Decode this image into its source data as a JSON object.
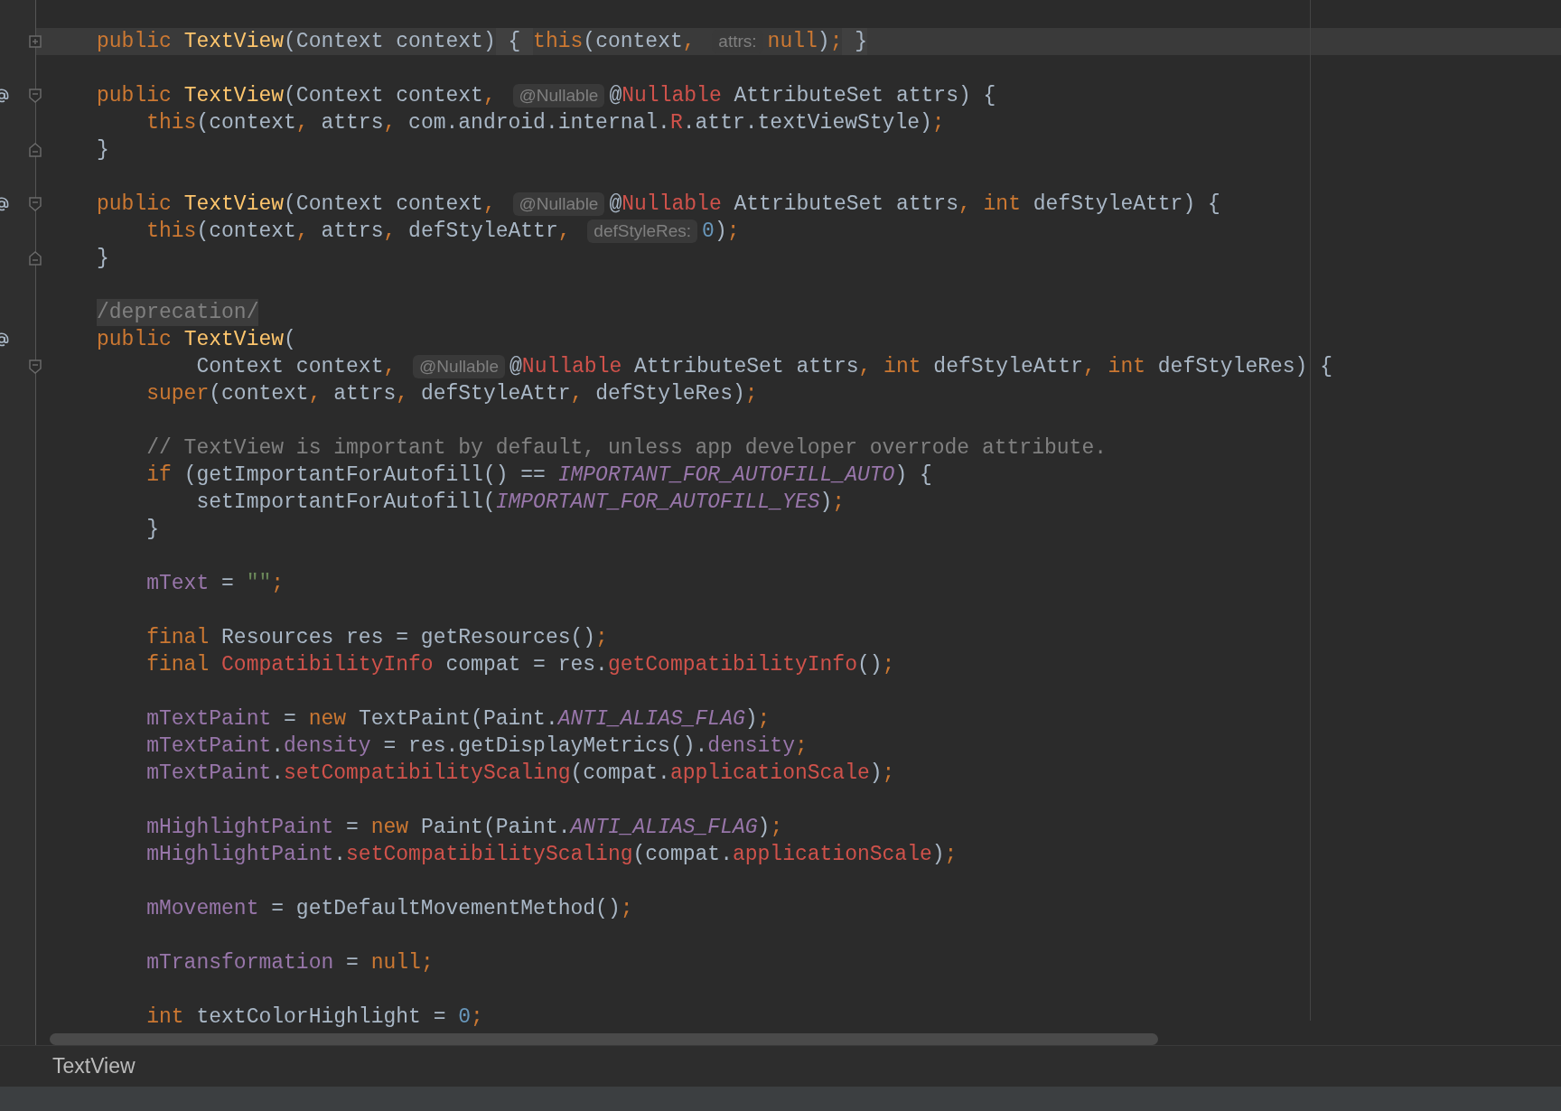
{
  "editor": {
    "lines": [
      {
        "tokens": [
          {
            "text": "public ",
            "kind": "keyword"
          },
          {
            "text": "TextView",
            "kind": "function"
          },
          {
            "text": "(Context context)",
            "kind": "plain"
          },
          {
            "text": " { ",
            "kind": "folded"
          },
          {
            "text": "this",
            "kind": "keyword"
          },
          {
            "text": "(context",
            "kind": "plain"
          },
          {
            "text": ", ",
            "kind": "keyword"
          },
          {
            "text": "attrs:",
            "kind": "hint"
          },
          {
            "text": "null",
            "kind": "keyword"
          },
          {
            "text": ")",
            "kind": "plain"
          },
          {
            "text": ";",
            "kind": "keyword"
          },
          {
            "text": " }",
            "kind": "folded"
          }
        ],
        "current": true,
        "marked": false,
        "fold": {
          "kind": "collapsed"
        }
      },
      {
        "current": false,
        "marked": false
      },
      {
        "tokens": [
          {
            "text": "public ",
            "kind": "keyword"
          },
          {
            "text": "TextView",
            "kind": "function"
          },
          {
            "text": "(Context context",
            "kind": "plain"
          },
          {
            "text": ", ",
            "kind": "keyword"
          },
          {
            "text": "@Nullable",
            "kind": "hint"
          },
          {
            "text": "@",
            "kind": "plain"
          },
          {
            "text": "Nullable",
            "kind": "error"
          },
          {
            "text": " AttributeSet attrs) {",
            "kind": "plain"
          }
        ],
        "current": false,
        "marked": true,
        "fold": {
          "kind": "start"
        }
      },
      {
        "tokens": [
          {
            "text": "    this",
            "kind": "keyword"
          },
          {
            "text": "(context",
            "kind": "plain"
          },
          {
            "text": ", ",
            "kind": "keyword"
          },
          {
            "text": "attrs",
            "kind": "plain"
          },
          {
            "text": ", ",
            "kind": "keyword"
          },
          {
            "text": "com.android.internal.",
            "kind": "plain"
          },
          {
            "text": "R",
            "kind": "error"
          },
          {
            "text": ".attr.textViewStyle)",
            "kind": "plain"
          },
          {
            "text": ";",
            "kind": "keyword"
          }
        ],
        "current": false,
        "marked": false
      },
      {
        "tokens": [
          {
            "text": "}",
            "kind": "plain"
          }
        ],
        "current": false,
        "marked": false,
        "fold": {
          "kind": "end"
        }
      },
      {
        "current": false,
        "marked": false
      },
      {
        "tokens": [
          {
            "text": "public ",
            "kind": "keyword"
          },
          {
            "text": "TextView",
            "kind": "function"
          },
          {
            "text": "(Context context",
            "kind": "plain"
          },
          {
            "text": ", ",
            "kind": "keyword"
          },
          {
            "text": "@Nullable",
            "kind": "hint"
          },
          {
            "text": "@",
            "kind": "plain"
          },
          {
            "text": "Nullable",
            "kind": "error"
          },
          {
            "text": " AttributeSet attrs",
            "kind": "plain"
          },
          {
            "text": ", ",
            "kind": "keyword"
          },
          {
            "text": "int ",
            "kind": "keyword"
          },
          {
            "text": "defStyleAttr) {",
            "kind": "plain"
          }
        ],
        "current": false,
        "marked": true,
        "fold": {
          "kind": "start"
        }
      },
      {
        "tokens": [
          {
            "text": "    this",
            "kind": "keyword"
          },
          {
            "text": "(context",
            "kind": "plain"
          },
          {
            "text": ", ",
            "kind": "keyword"
          },
          {
            "text": "attrs",
            "kind": "plain"
          },
          {
            "text": ", ",
            "kind": "keyword"
          },
          {
            "text": "defStyleAttr",
            "kind": "plain"
          },
          {
            "text": ", ",
            "kind": "keyword"
          },
          {
            "text": "defStyleRes:",
            "kind": "hint"
          },
          {
            "text": "0",
            "kind": "number"
          },
          {
            "text": ")",
            "kind": "plain"
          },
          {
            "text": ";",
            "kind": "keyword"
          }
        ],
        "current": false,
        "marked": false
      },
      {
        "tokens": [
          {
            "text": "}",
            "kind": "plain"
          }
        ],
        "current": false,
        "marked": false,
        "fold": {
          "kind": "end"
        }
      },
      {
        "current": false,
        "marked": false
      },
      {
        "tokens": [
          {
            "text": "/deprecation/",
            "kind": "deprecation"
          }
        ],
        "current": false,
        "marked": false
      },
      {
        "tokens": [
          {
            "text": "public ",
            "kind": "keyword"
          },
          {
            "text": "TextView",
            "kind": "function"
          },
          {
            "text": "(",
            "kind": "plain"
          }
        ],
        "current": false,
        "marked": true
      },
      {
        "tokens": [
          {
            "text": "        Context context",
            "kind": "plain"
          },
          {
            "text": ", ",
            "kind": "keyword"
          },
          {
            "text": "@Nullable",
            "kind": "hint"
          },
          {
            "text": "@",
            "kind": "plain"
          },
          {
            "text": "Nullable",
            "kind": "error"
          },
          {
            "text": " AttributeSet attrs",
            "kind": "plain"
          },
          {
            "text": ", ",
            "kind": "keyword"
          },
          {
            "text": "int ",
            "kind": "keyword"
          },
          {
            "text": "defStyleAttr",
            "kind": "plain"
          },
          {
            "text": ", ",
            "kind": "keyword"
          },
          {
            "text": "int ",
            "kind": "keyword"
          },
          {
            "text": "defStyleRes) {",
            "kind": "plain"
          }
        ],
        "current": false,
        "marked": false,
        "fold": {
          "kind": "start"
        }
      },
      {
        "tokens": [
          {
            "text": "    super",
            "kind": "keyword"
          },
          {
            "text": "(context",
            "kind": "plain"
          },
          {
            "text": ", ",
            "kind": "keyword"
          },
          {
            "text": "attrs",
            "kind": "plain"
          },
          {
            "text": ", ",
            "kind": "keyword"
          },
          {
            "text": "defStyleAttr",
            "kind": "plain"
          },
          {
            "text": ", ",
            "kind": "keyword"
          },
          {
            "text": "defStyleRes)",
            "kind": "plain"
          },
          {
            "text": ";",
            "kind": "keyword"
          }
        ],
        "current": false,
        "marked": false
      },
      {
        "current": false,
        "marked": false
      },
      {
        "tokens": [
          {
            "text": "    // TextView is important by default, unless app developer overrode attribute.",
            "kind": "comment"
          }
        ],
        "current": false,
        "marked": false
      },
      {
        "tokens": [
          {
            "text": "    if ",
            "kind": "keyword"
          },
          {
            "text": "(getImportantForAutofill() == ",
            "kind": "plain"
          },
          {
            "text": "IMPORTANT_FOR_AUTOFILL_AUTO",
            "kind": "static"
          },
          {
            "text": ") {",
            "kind": "plain"
          }
        ],
        "current": false,
        "marked": false
      },
      {
        "tokens": [
          {
            "text": "        setImportantForAutofill(",
            "kind": "plain"
          },
          {
            "text": "IMPORTANT_FOR_AUTOFILL_YES",
            "kind": "static"
          },
          {
            "text": ")",
            "kind": "plain"
          },
          {
            "text": ";",
            "kind": "keyword"
          }
        ],
        "current": false,
        "marked": false
      },
      {
        "tokens": [
          {
            "text": "    }",
            "kind": "plain"
          }
        ],
        "current": false,
        "marked": false
      },
      {
        "current": false,
        "marked": false
      },
      {
        "tokens": [
          {
            "text": "    mText",
            "kind": "field"
          },
          {
            "text": " = ",
            "kind": "plain"
          },
          {
            "text": "\"\"",
            "kind": "string"
          },
          {
            "text": ";",
            "kind": "keyword"
          }
        ],
        "current": false,
        "marked": false
      },
      {
        "current": false,
        "marked": false
      },
      {
        "tokens": [
          {
            "text": "    final ",
            "kind": "keyword"
          },
          {
            "text": "Resources res = getResources()",
            "kind": "plain"
          },
          {
            "text": ";",
            "kind": "keyword"
          }
        ],
        "current": false,
        "marked": false
      },
      {
        "tokens": [
          {
            "text": "    final ",
            "kind": "keyword"
          },
          {
            "text": "CompatibilityInfo",
            "kind": "error"
          },
          {
            "text": " compat = res.",
            "kind": "plain"
          },
          {
            "text": "getCompatibilityInfo",
            "kind": "error"
          },
          {
            "text": "()",
            "kind": "plain"
          },
          {
            "text": ";",
            "kind": "keyword"
          }
        ],
        "current": false,
        "marked": false
      },
      {
        "current": false,
        "marked": false
      },
      {
        "tokens": [
          {
            "text": "    mTextPaint",
            "kind": "field"
          },
          {
            "text": " = ",
            "kind": "plain"
          },
          {
            "text": "new ",
            "kind": "keyword"
          },
          {
            "text": "TextPaint(Paint.",
            "kind": "plain"
          },
          {
            "text": "ANTI_ALIAS_FLAG",
            "kind": "static"
          },
          {
            "text": ")",
            "kind": "plain"
          },
          {
            "text": ";",
            "kind": "keyword"
          }
        ],
        "current": false,
        "marked": false
      },
      {
        "tokens": [
          {
            "text": "    mTextPaint",
            "kind": "field"
          },
          {
            "text": ".",
            "kind": "plain"
          },
          {
            "text": "density",
            "kind": "field"
          },
          {
            "text": " = res.getDisplayMetrics().",
            "kind": "plain"
          },
          {
            "text": "density",
            "kind": "field"
          },
          {
            "text": ";",
            "kind": "keyword"
          }
        ],
        "current": false,
        "marked": false
      },
      {
        "tokens": [
          {
            "text": "    mTextPaint",
            "kind": "field"
          },
          {
            "text": ".",
            "kind": "plain"
          },
          {
            "text": "setCompatibilityScaling",
            "kind": "error"
          },
          {
            "text": "(compat.",
            "kind": "plain"
          },
          {
            "text": "applicationScale",
            "kind": "error"
          },
          {
            "text": ")",
            "kind": "plain"
          },
          {
            "text": ";",
            "kind": "keyword"
          }
        ],
        "current": false,
        "marked": false
      },
      {
        "current": false,
        "marked": false
      },
      {
        "tokens": [
          {
            "text": "    mHighlightPaint",
            "kind": "field"
          },
          {
            "text": " = ",
            "kind": "plain"
          },
          {
            "text": "new ",
            "kind": "keyword"
          },
          {
            "text": "Paint(Paint.",
            "kind": "plain"
          },
          {
            "text": "ANTI_ALIAS_FLAG",
            "kind": "static"
          },
          {
            "text": ")",
            "kind": "plain"
          },
          {
            "text": ";",
            "kind": "keyword"
          }
        ],
        "current": false,
        "marked": false
      },
      {
        "tokens": [
          {
            "text": "    mHighlightPaint",
            "kind": "field"
          },
          {
            "text": ".",
            "kind": "plain"
          },
          {
            "text": "setCompatibilityScaling",
            "kind": "error"
          },
          {
            "text": "(compat.",
            "kind": "plain"
          },
          {
            "text": "applicationScale",
            "kind": "error"
          },
          {
            "text": ")",
            "kind": "plain"
          },
          {
            "text": ";",
            "kind": "keyword"
          }
        ],
        "current": false,
        "marked": false
      },
      {
        "current": false,
        "marked": false
      },
      {
        "tokens": [
          {
            "text": "    mMovement",
            "kind": "field"
          },
          {
            "text": " = getDefaultMovementMethod()",
            "kind": "plain"
          },
          {
            "text": ";",
            "kind": "keyword"
          }
        ],
        "current": false,
        "marked": false
      },
      {
        "current": false,
        "marked": false
      },
      {
        "tokens": [
          {
            "text": "    mTransformation",
            "kind": "field"
          },
          {
            "text": " = ",
            "kind": "plain"
          },
          {
            "text": "null",
            "kind": "keyword"
          },
          {
            "text": ";",
            "kind": "keyword"
          }
        ],
        "current": false,
        "marked": false
      },
      {
        "current": false,
        "marked": false
      },
      {
        "tokens": [
          {
            "text": "    int ",
            "kind": "keyword"
          },
          {
            "text": "textColorHighlight = ",
            "kind": "plain"
          },
          {
            "text": "0",
            "kind": "number"
          },
          {
            "text": ";",
            "kind": "keyword"
          }
        ],
        "current": false,
        "marked": false
      }
    ]
  },
  "status_bar": {
    "breadcrumb": "TextView"
  }
}
